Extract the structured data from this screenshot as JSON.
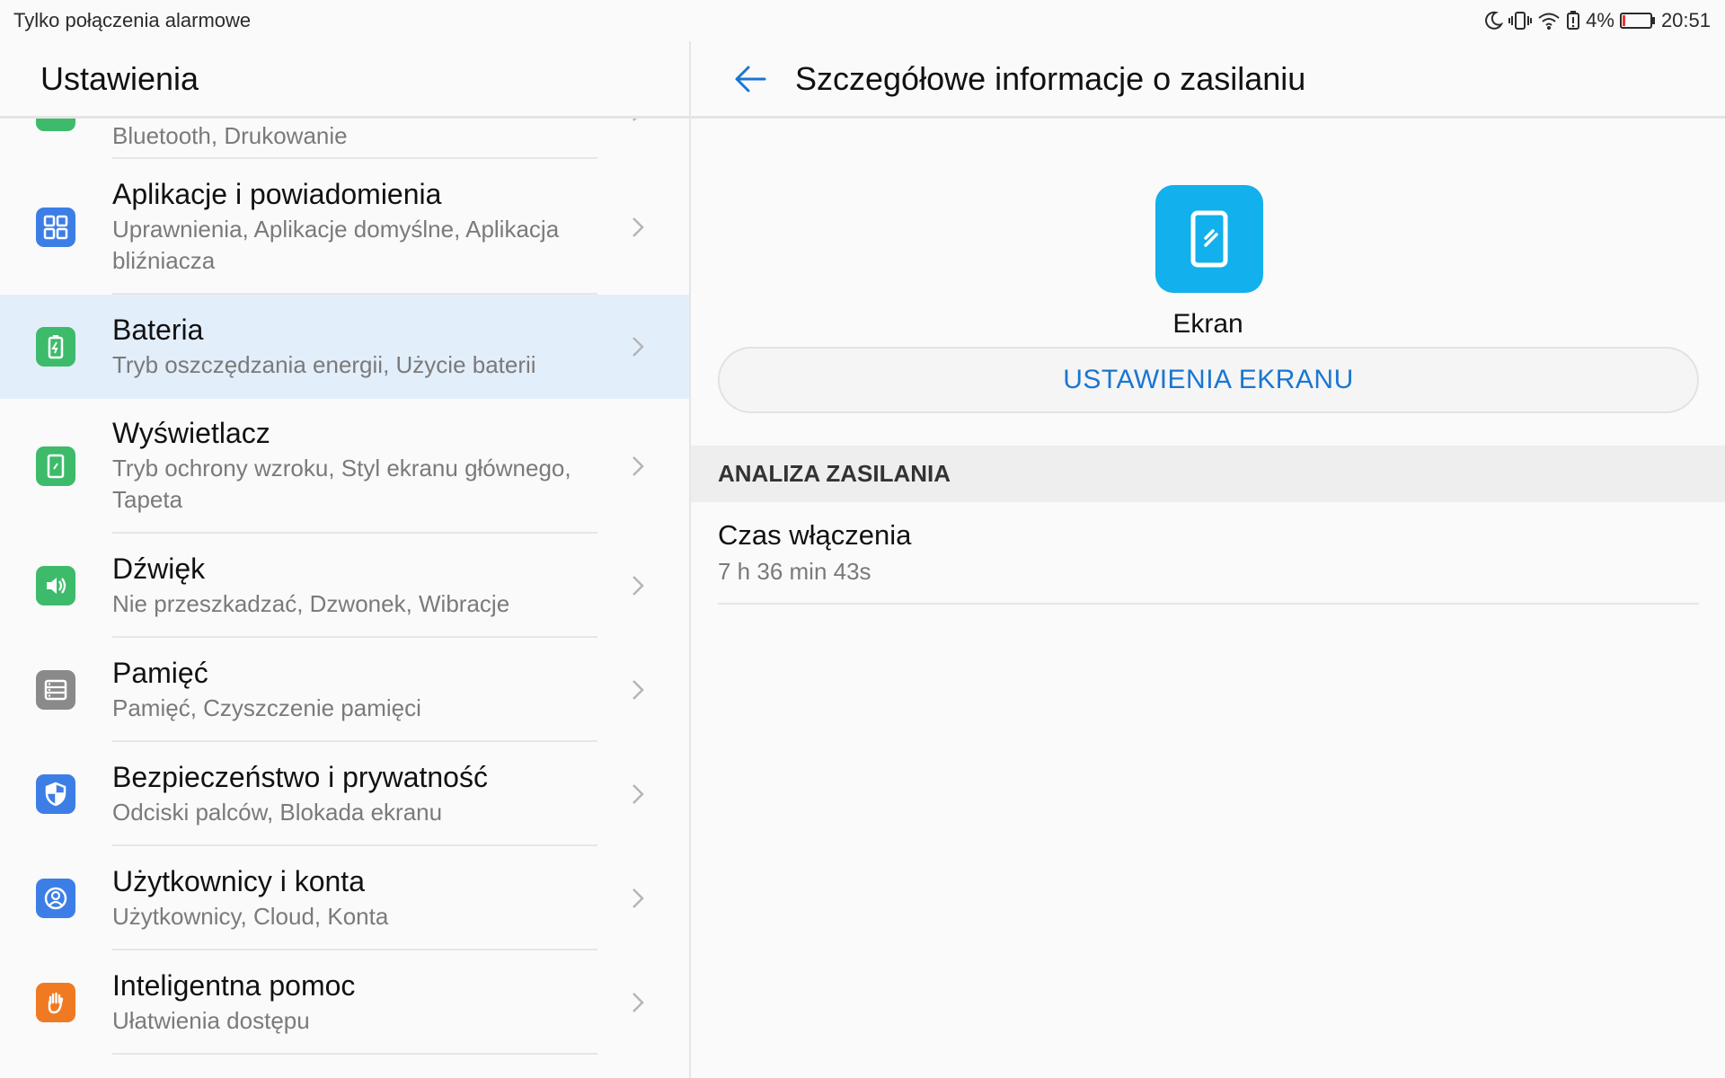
{
  "status_bar": {
    "carrier_text": "Tylko połączenia alarmowe",
    "battery_percent": "4%",
    "time": "20:51",
    "icons": [
      "moon-icon",
      "vibrate-icon",
      "wifi-icon",
      "battery-alert-icon",
      "battery-icon"
    ]
  },
  "left_pane": {
    "title": "Ustawienia",
    "items": [
      {
        "title": "",
        "subtitle": "Bluetooth, Drukowanie",
        "icon": "device-connectivity-icon",
        "color": "#3dbb6b"
      },
      {
        "title": "Aplikacje i powiadomienia",
        "subtitle": "Uprawnienia, Aplikacje domyślne, Aplikacja bliźniacza",
        "icon": "apps-grid-icon",
        "color": "#3d7ee6"
      },
      {
        "title": "Bateria",
        "subtitle": "Tryb oszczędzania energii, Użycie baterii",
        "icon": "battery-charge-icon",
        "color": "#3dbb6b"
      },
      {
        "title": "Wyświetlacz",
        "subtitle": "Tryb ochrony wzroku, Styl ekranu głównego, Tapeta",
        "icon": "display-icon",
        "color": "#3dbb6b"
      },
      {
        "title": "Dźwięk",
        "subtitle": "Nie przeszkadzać, Dzwonek, Wibracje",
        "icon": "speaker-icon",
        "color": "#3dbb6b"
      },
      {
        "title": "Pamięć",
        "subtitle": "Pamięć, Czyszczenie pamięci",
        "icon": "storage-icon",
        "color": "#8a8a8a"
      },
      {
        "title": "Bezpieczeństwo i prywatność",
        "subtitle": "Odciski palców, Blokada ekranu",
        "icon": "shield-icon",
        "color": "#3d7ee6"
      },
      {
        "title": "Użytkownicy i konta",
        "subtitle": "Użytkownicy, Cloud, Konta",
        "icon": "user-icon",
        "color": "#3d7ee6"
      },
      {
        "title": "Inteligentna pomoc",
        "subtitle": "Ułatwienia dostępu",
        "icon": "hand-icon",
        "color": "#f07a22"
      }
    ]
  },
  "right_pane": {
    "title": "Szczegółowe informacje o zasilaniu",
    "app_name": "Ekran",
    "app_icon": "screen-icon",
    "app_icon_color": "#12b0ec",
    "settings_button": "USTAWIENIA EKRANU",
    "section_title": "ANALIZA ZASILANIA",
    "stat": {
      "label": "Czas włączenia",
      "value": "7 h 36 min 43s"
    }
  },
  "colors": {
    "accent": "#1976d2",
    "selected_row": "#e3eefb"
  }
}
